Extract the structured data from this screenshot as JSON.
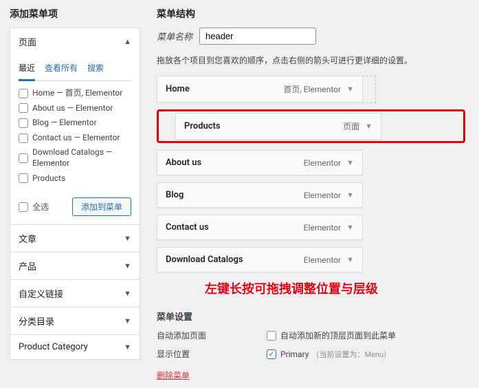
{
  "left": {
    "title": "添加菜单项",
    "sections": {
      "pages": {
        "label": "页面",
        "tabs": {
          "recent": "最近",
          "view_all": "查看所有",
          "search": "搜索"
        },
        "items": [
          "Home — 首页, Elementor",
          "About us — Elementor",
          "Blog — Elementor",
          "Contact us — Elementor",
          "Download Catalogs — Elementor",
          "Products"
        ],
        "select_all": "全选",
        "add_btn": "添加到菜单"
      },
      "posts": "文章",
      "products": "产品",
      "custom_links": "自定义链接",
      "categories": "分类目录",
      "product_category": "Product Category"
    }
  },
  "right": {
    "title": "菜单结构",
    "name_label": "菜单名称",
    "name_value": "header",
    "drag_hint": "拖放各个项目到您喜欢的顺序，点击右侧的箭头可进行更详细的设置。",
    "menu_items": [
      {
        "title": "Home",
        "meta": "首页, Elementor",
        "indented": false,
        "highlighted": false,
        "has_slot": true
      },
      {
        "title": "Products",
        "meta": "页面",
        "indented": true,
        "highlighted": true,
        "has_slot": false
      },
      {
        "title": "About us",
        "meta": "Elementor",
        "indented": false,
        "highlighted": false,
        "has_slot": false
      },
      {
        "title": "Blog",
        "meta": "Elementor",
        "indented": false,
        "highlighted": false,
        "has_slot": false
      },
      {
        "title": "Contact us",
        "meta": "Elementor",
        "indented": false,
        "highlighted": false,
        "has_slot": false
      },
      {
        "title": "Download Catalogs",
        "meta": "Elementor",
        "indented": false,
        "highlighted": false,
        "has_slot": false
      }
    ],
    "drag_overlay": "左键长按可拖拽调整位置与层级",
    "settings": {
      "title": "菜单设置",
      "auto_add_label": "自动添加页面",
      "auto_add_text": "自动添加新的顶层页面到此菜单",
      "display_label": "显示位置",
      "display_option": "Primary",
      "display_note": "（当前设置为：Menu）"
    },
    "delete": "删除菜单"
  }
}
